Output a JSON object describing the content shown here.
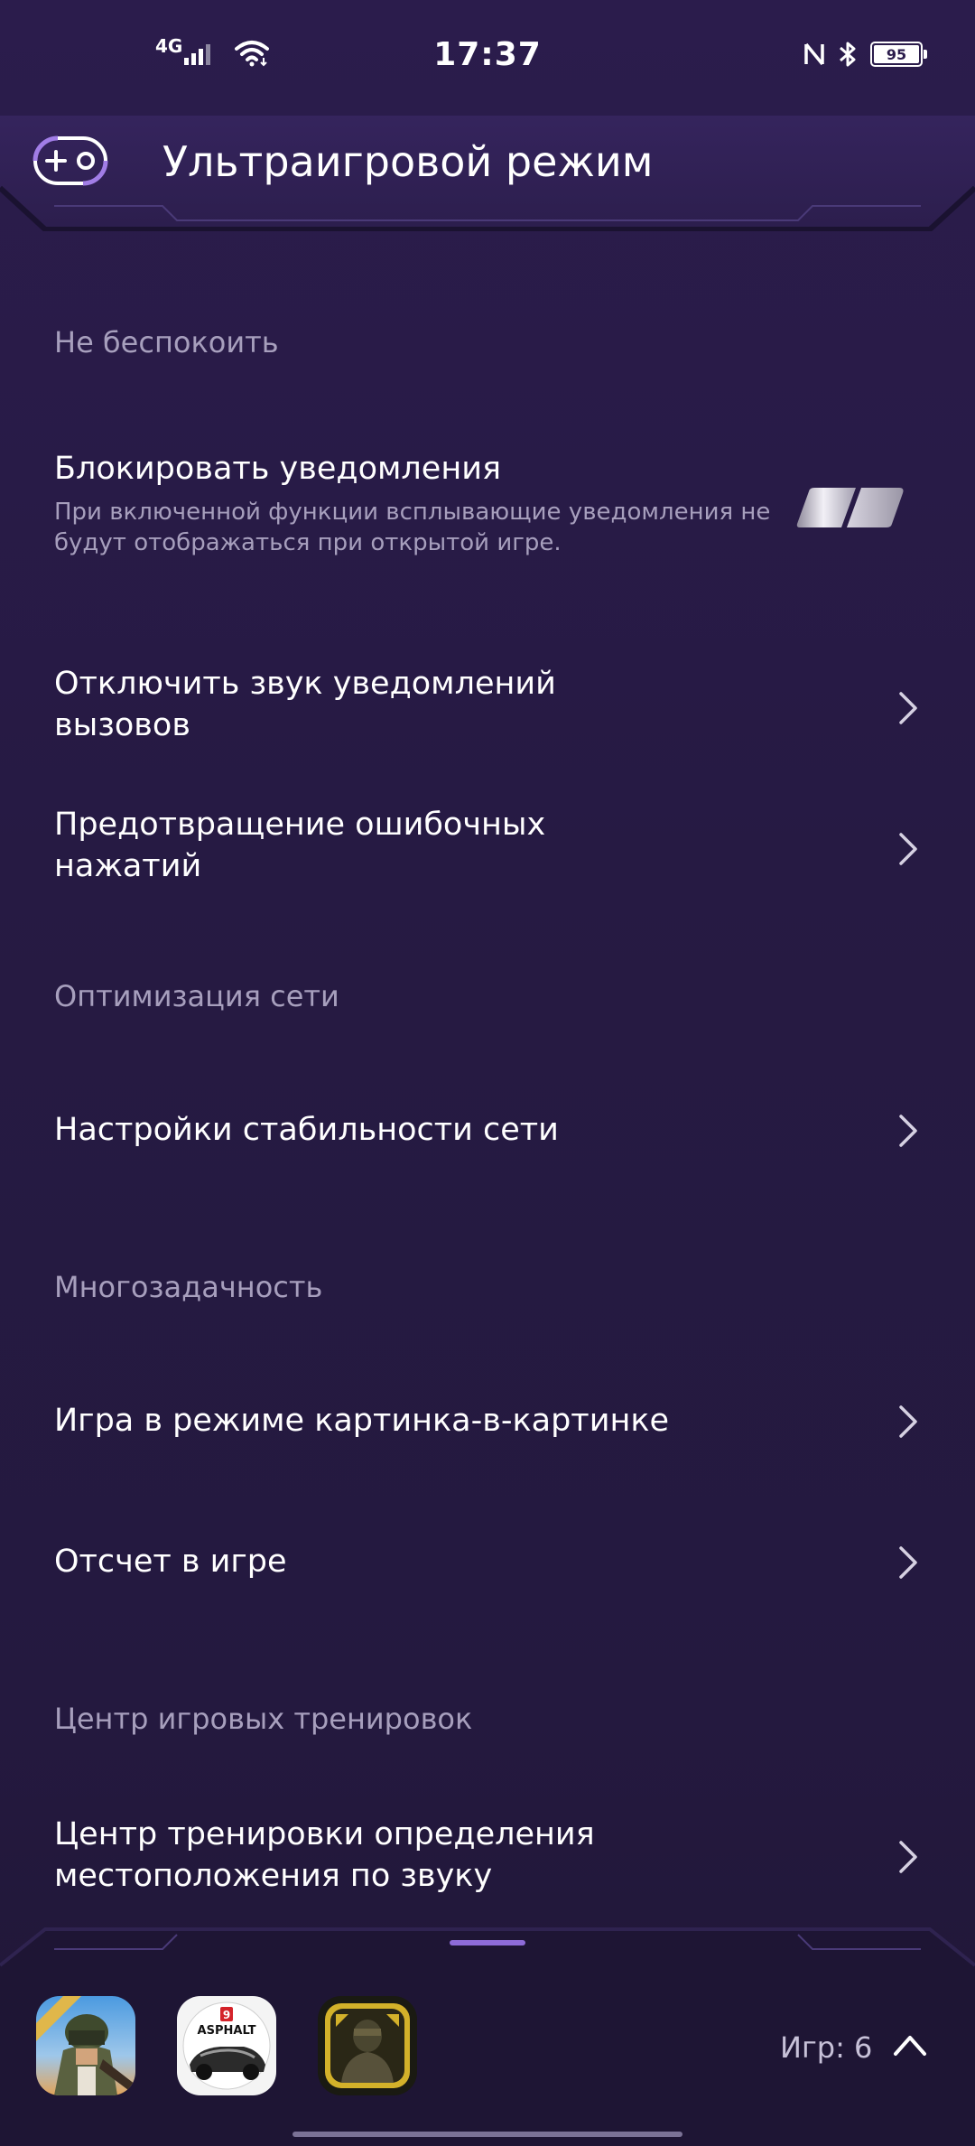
{
  "status_bar": {
    "time": "17:37",
    "network_type": "4G",
    "battery_percent": "95",
    "battery_level": 0.95
  },
  "header": {
    "title": "Ультраигровой режим",
    "icon": "gamepad-icon"
  },
  "sections": {
    "do_not_disturb": {
      "title": "Не беспокоить",
      "block_notifications": {
        "title": "Блокировать уведомления",
        "description": "При включенной функции всплывающие уведомления не будут отображаться при открытой игре.",
        "toggle_on": false
      },
      "mute_call_notifications": {
        "title": "Отключить звук уведомлений вызовов"
      },
      "prevent_accidental_taps": {
        "title": "Предотвращение ошибочных нажатий"
      }
    },
    "network_optimization": {
      "title": "Оптимизация сети",
      "stability_settings": {
        "title": "Настройки стабильности сети"
      }
    },
    "multitasking": {
      "title": "Многозадачность",
      "pip_game": {
        "title": "Игра в режиме картинка-в-картинке"
      },
      "in_game_countdown": {
        "title": "Отсчет в игре"
      }
    },
    "training_center": {
      "title": "Центр игровых тренировок",
      "sound_location": {
        "title": "Центр тренировки определения местоположения по звуку"
      }
    }
  },
  "tray": {
    "games": [
      {
        "icon": "pubg-icon"
      },
      {
        "icon": "asphalt-icon",
        "badge": "9",
        "label": "ASPHALT"
      },
      {
        "icon": "call-of-duty-icon"
      }
    ],
    "games_count": "Игр: 6"
  },
  "colors": {
    "background": "#261a43",
    "accent": "#8e6bd9",
    "secondary_text": "#a79fbd"
  }
}
